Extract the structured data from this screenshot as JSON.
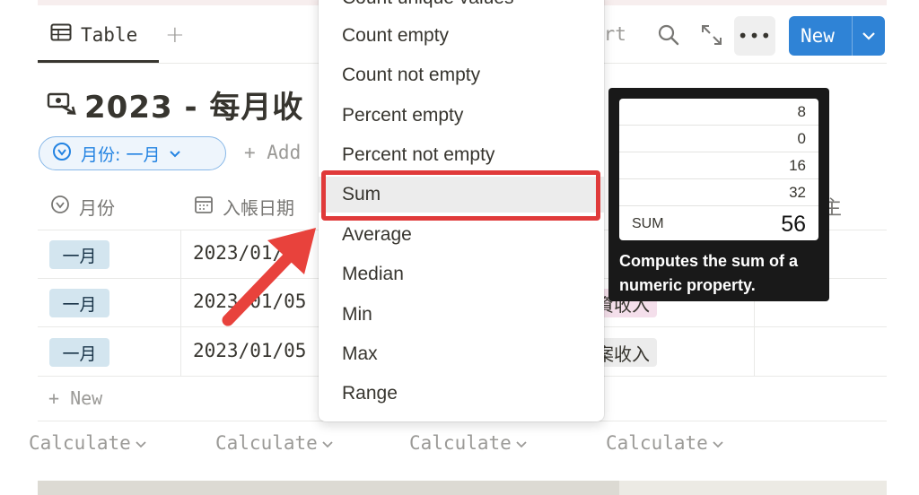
{
  "toolbar": {
    "view_tab_label": "Table",
    "add_view_label": "+",
    "sort_label": "ort",
    "more_label": "•••",
    "new_label": "New"
  },
  "page": {
    "title": "2023 - 每月收"
  },
  "filter": {
    "chip_label": "月份: 一月",
    "add_label": "+ Add"
  },
  "table": {
    "headers": {
      "month": "月份",
      "date": "入帳日期",
      "right_partial": "主"
    },
    "rows": [
      {
        "month": "一月",
        "date": "2023/01/03",
        "category": ""
      },
      {
        "month": "一月",
        "date": "2023/01/05",
        "category": "資收入"
      },
      {
        "month": "一月",
        "date": "2023/01/05",
        "category": "案收入"
      }
    ],
    "new_row_label": "+ New",
    "calculate_labels": [
      "Calculate",
      "Calculate",
      "Calculate",
      "Calculate"
    ]
  },
  "menu": {
    "items": [
      {
        "label": "Count unique values"
      },
      {
        "label": "Count empty"
      },
      {
        "label": "Count not empty"
      },
      {
        "label": "Percent empty"
      },
      {
        "label": "Percent not empty"
      },
      {
        "label": "Sum",
        "selected": true
      },
      {
        "label": "Average"
      },
      {
        "label": "Median"
      },
      {
        "label": "Min"
      },
      {
        "label": "Max"
      },
      {
        "label": "Range"
      }
    ]
  },
  "tooltip": {
    "values": [
      "8",
      "0",
      "16",
      "32"
    ],
    "sum_label": "SUM",
    "sum_value": "56",
    "description": "Computes the sum of a numeric property."
  },
  "colors": {
    "accent_blue": "#2f83d6",
    "highlight_red": "#e03a3a",
    "month_tag_bg": "#d3e5ef",
    "pink_tag_bg": "#f4dfeb",
    "gray_tag_bg": "#ececec"
  }
}
